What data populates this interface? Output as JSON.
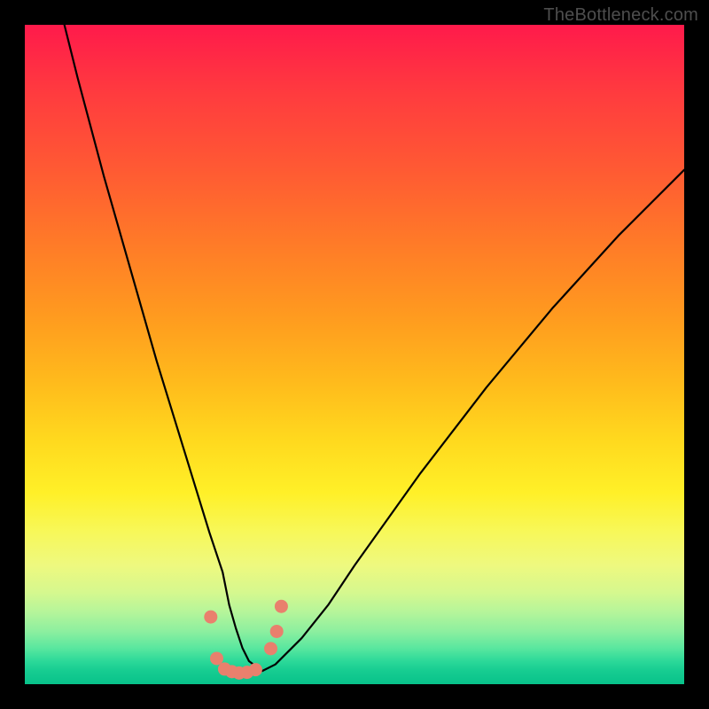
{
  "watermark": "TheBottleneck.com",
  "chart_data": {
    "type": "line",
    "title": "",
    "xlabel": "",
    "ylabel": "",
    "xlim": [
      0,
      100
    ],
    "ylim": [
      0,
      100
    ],
    "grid": false,
    "series": [
      {
        "name": "bottleneck-curve",
        "x": [
          6,
          8,
          10,
          12,
          14,
          16,
          18,
          20,
          22,
          24,
          26,
          28,
          30,
          31,
          32,
          33,
          34,
          36,
          38,
          42,
          46,
          50,
          55,
          60,
          65,
          70,
          75,
          80,
          85,
          90,
          95,
          100
        ],
        "values": [
          100,
          92,
          84.5,
          77,
          70,
          63,
          56,
          49,
          42.5,
          36,
          29.5,
          23,
          17,
          12,
          8.5,
          5.5,
          3.5,
          2,
          3,
          7,
          12,
          18,
          25,
          32,
          38.5,
          45,
          51,
          57,
          62.5,
          68,
          73,
          78
        ]
      }
    ],
    "markers": {
      "name": "highlighted-points",
      "color": "#e9806d",
      "points": [
        {
          "x": 28.2,
          "y": 10.2
        },
        {
          "x": 29.1,
          "y": 3.9
        },
        {
          "x": 30.3,
          "y": 2.3
        },
        {
          "x": 31.4,
          "y": 1.9
        },
        {
          "x": 32.5,
          "y": 1.7
        },
        {
          "x": 33.7,
          "y": 1.8
        },
        {
          "x": 35.0,
          "y": 2.2
        },
        {
          "x": 37.3,
          "y": 5.4
        },
        {
          "x": 38.2,
          "y": 8.0
        },
        {
          "x": 38.9,
          "y": 11.8
        }
      ]
    }
  }
}
